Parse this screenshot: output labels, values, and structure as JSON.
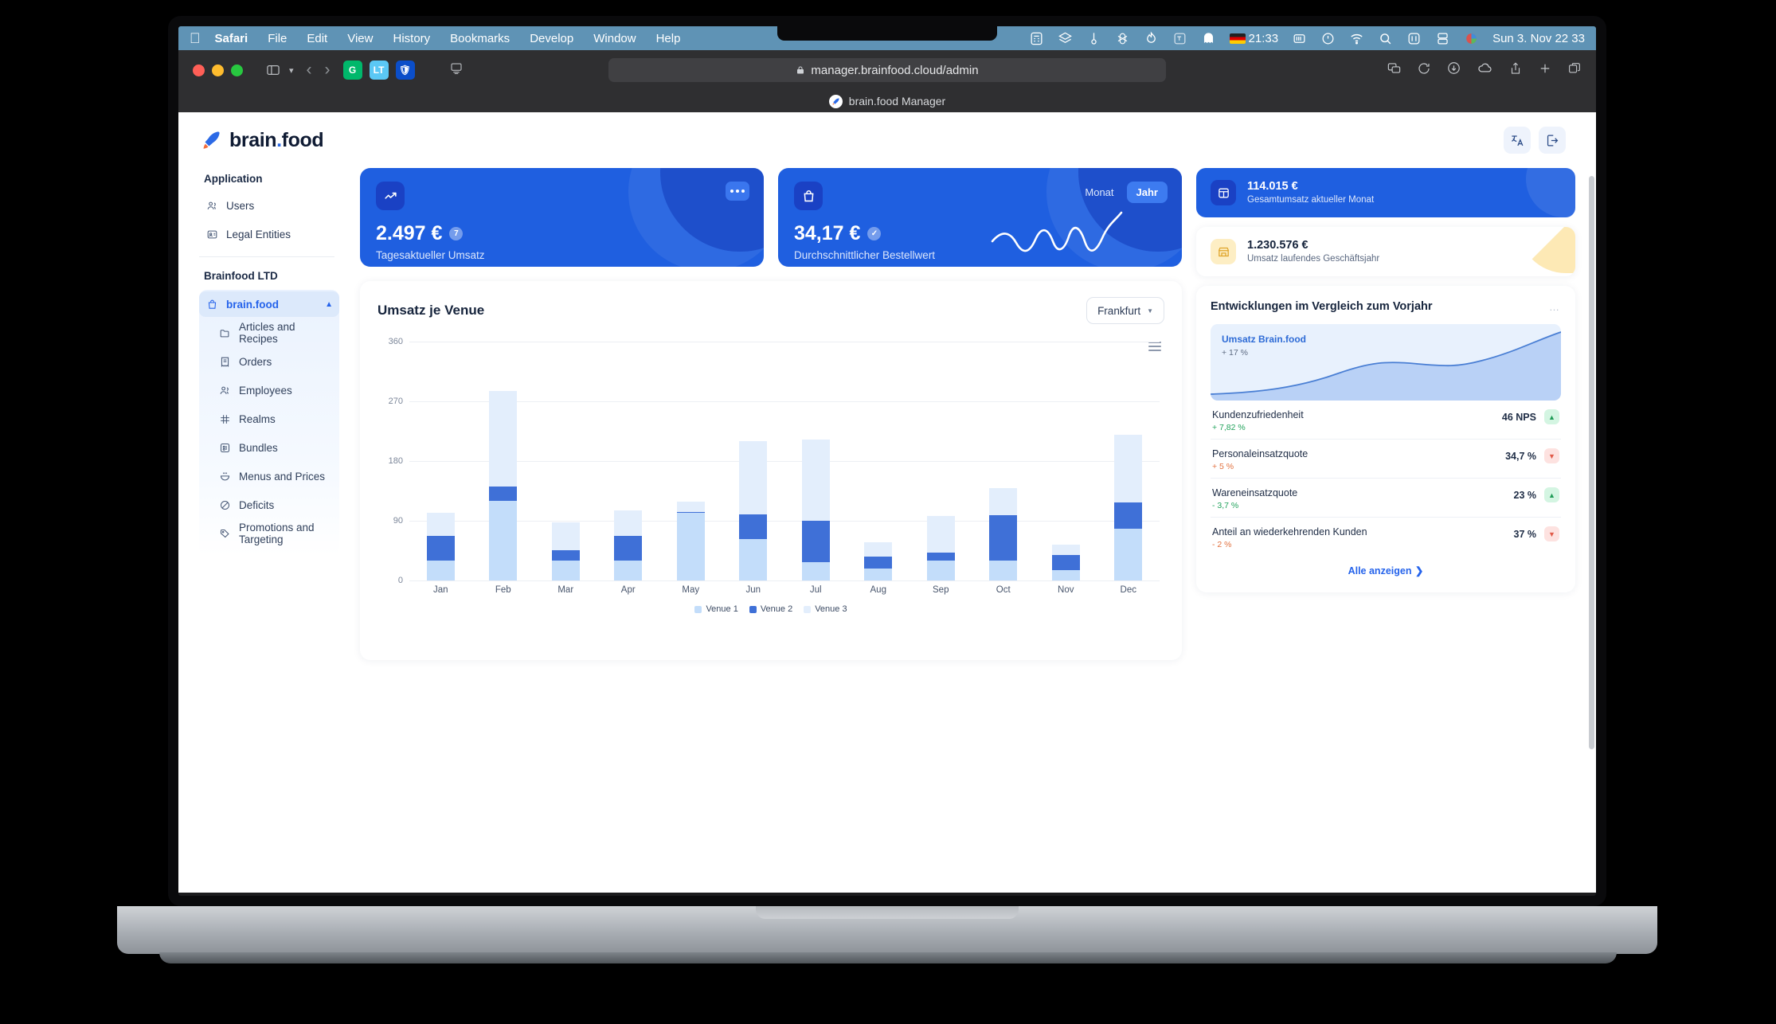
{
  "menubar": {
    "app_name": "Safari",
    "items": [
      "File",
      "Edit",
      "View",
      "History",
      "Bookmarks",
      "Develop",
      "Window",
      "Help"
    ],
    "tray_time_secondary": "21:33",
    "clock": "Sun 3. Nov  22 33"
  },
  "browser": {
    "url": "manager.brainfood.cloud/admin",
    "tab_title": "brain.food Manager"
  },
  "app": {
    "logo_main": "brain",
    "logo_dot": ".",
    "logo_suffix": "food"
  },
  "sidebar": {
    "section_application": "Application",
    "application_items": [
      {
        "label": "Users",
        "icon": "users-icon"
      },
      {
        "label": "Legal Entities",
        "icon": "id-card-icon"
      }
    ],
    "section_company": "Brainfood LTD",
    "company_root": {
      "label": "brain.food",
      "icon": "bag-icon"
    },
    "company_items": [
      {
        "label": "Articles and Recipes",
        "icon": "folder-icon"
      },
      {
        "label": "Orders",
        "icon": "receipt-icon"
      },
      {
        "label": "Employees",
        "icon": "users-icon"
      },
      {
        "label": "Realms",
        "icon": "grid-icon"
      },
      {
        "label": "Bundles",
        "icon": "box-icon"
      },
      {
        "label": "Menus and Prices",
        "icon": "bowl-icon"
      },
      {
        "label": "Deficits",
        "icon": "no-entry-icon"
      },
      {
        "label": "Promotions and Targeting",
        "icon": "tag-icon"
      }
    ]
  },
  "kpi_cards": [
    {
      "value": "2.497 €",
      "badge": "7",
      "label": "Tagesaktueller Umsatz",
      "icon": "trending-up-icon"
    },
    {
      "value": "34,17 €",
      "badge": "✓",
      "label": "Durchschnittlicher Bestellwert",
      "icon": "shopping-bag-icon",
      "segments": [
        {
          "label": "Monat",
          "selected": false
        },
        {
          "label": "Jahr",
          "selected": true
        }
      ]
    }
  ],
  "mini_cards": [
    {
      "value": "114.015 €",
      "label": "Gesamtumsatz aktueller Monat",
      "icon": "table-icon",
      "style": "blue"
    },
    {
      "value": "1.230.576 €",
      "label": "Umsatz laufendes Geschäftsjahr",
      "icon": "storefront-icon",
      "style": "white"
    }
  ],
  "chart_panel": {
    "title": "Umsatz je Venue",
    "venue_selected": "Frankfurt",
    "menu_icon": "hamburger-menu-icon"
  },
  "chart_data": {
    "type": "bar",
    "stacked": true,
    "title": "Umsatz je Venue",
    "xlabel": "",
    "ylabel": "",
    "ylim": [
      0,
      360
    ],
    "yticks": [
      0,
      90,
      180,
      270,
      360
    ],
    "grid": true,
    "legend_position": "bottom",
    "categories": [
      "Jan",
      "Feb",
      "Mar",
      "Apr",
      "May",
      "Jun",
      "Jul",
      "Aug",
      "Sep",
      "Oct",
      "Nov",
      "Dec"
    ],
    "series": [
      {
        "name": "Venue 1",
        "color": "#c3ddfa",
        "values": [
          30,
          120,
          30,
          30,
          102,
          62,
          28,
          18,
          30,
          30,
          16,
          78
        ]
      },
      {
        "name": "Venue 2",
        "color": "#3f70d7",
        "values": [
          37,
          22,
          16,
          37,
          1,
          38,
          62,
          18,
          12,
          68,
          22,
          40
        ]
      },
      {
        "name": "Venue 3",
        "color": "#e3eefc",
        "values": [
          35,
          144,
          42,
          39,
          16,
          110,
          122,
          22,
          55,
          41,
          16,
          102
        ]
      }
    ]
  },
  "developments": {
    "title": "Entwicklungen im Vergleich zum Vorjahr",
    "menu_icon": "ellipsis-icon",
    "area_chart": {
      "label": "Umsatz Brain.food",
      "delta": "+ 17 %"
    },
    "rows": [
      {
        "name": "Kundenzufriedenheit",
        "delta": "+ 7,82 %",
        "direction": "up",
        "value": "46 NPS",
        "pill": "green"
      },
      {
        "name": "Personaleinsatzquote",
        "delta": "+ 5 %",
        "direction": "down",
        "value": "34,7 %",
        "pill": "red"
      },
      {
        "name": "Wareneinsatzquote",
        "delta": "- 3,7 %",
        "direction": "up",
        "value": "23 %",
        "pill": "green"
      },
      {
        "name": "Anteil an wiederkehrenden Kunden",
        "delta": "- 2 %",
        "direction": "down",
        "value": "37 %",
        "pill": "red"
      }
    ],
    "show_all": "Alle anzeigen"
  }
}
